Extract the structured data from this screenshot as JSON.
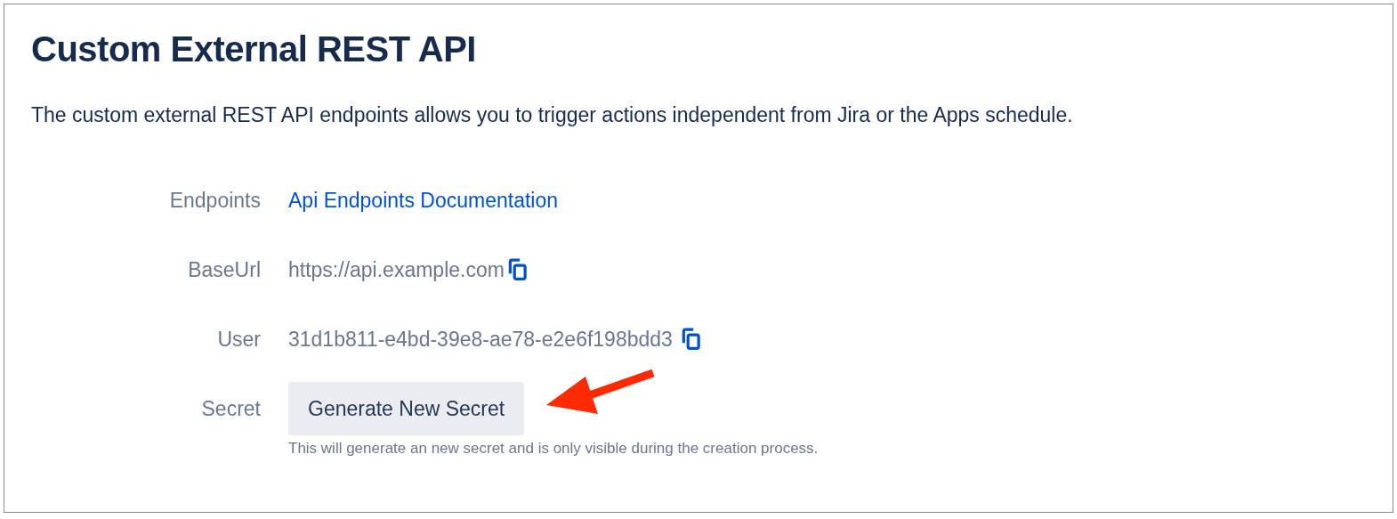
{
  "title": "Custom External REST API",
  "description": "The custom external REST API endpoints allows you to trigger actions independent from Jira or the Apps schedule.",
  "fields": [
    {
      "label": "Endpoints",
      "kind": "link",
      "value": "Api Endpoints Documentation"
    },
    {
      "label": "BaseUrl",
      "kind": "copy",
      "value": "https://api.example.com"
    },
    {
      "label": "User",
      "kind": "copy",
      "value": "31d1b811-e4bd-39e8-ae78-e2e6f198bdd3 "
    },
    {
      "label": "Secret",
      "kind": "button",
      "value": "Generate New Secret",
      "hint": "This will generate an new secret and is only visible during the creation process."
    }
  ]
}
